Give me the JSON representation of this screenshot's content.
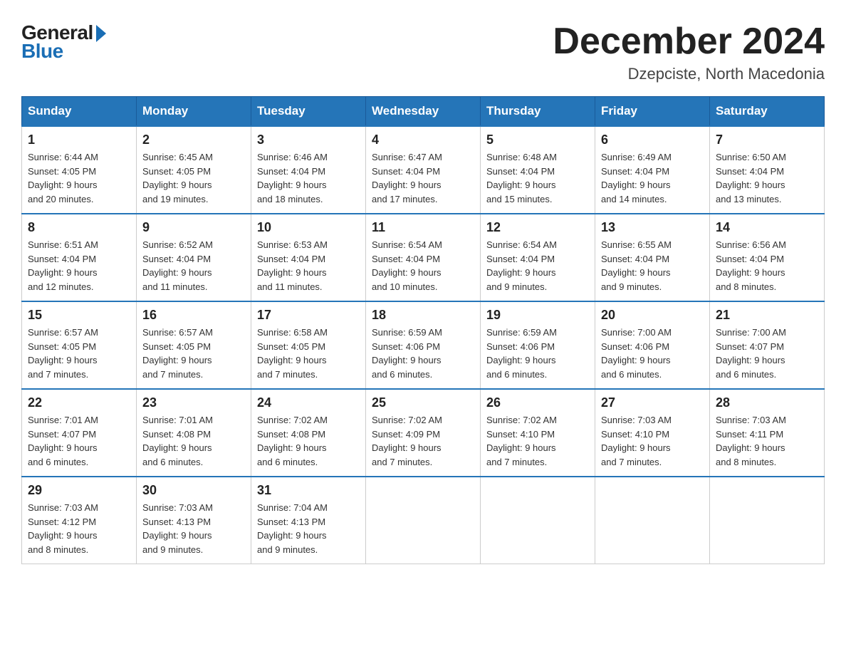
{
  "header": {
    "logo": {
      "general": "General",
      "blue": "Blue"
    },
    "title": "December 2024",
    "location": "Dzepciste, North Macedonia"
  },
  "days_header": [
    "Sunday",
    "Monday",
    "Tuesday",
    "Wednesday",
    "Thursday",
    "Friday",
    "Saturday"
  ],
  "weeks": [
    [
      {
        "day": "1",
        "sunrise": "6:44 AM",
        "sunset": "4:05 PM",
        "daylight": "9 hours and 20 minutes."
      },
      {
        "day": "2",
        "sunrise": "6:45 AM",
        "sunset": "4:05 PM",
        "daylight": "9 hours and 19 minutes."
      },
      {
        "day": "3",
        "sunrise": "6:46 AM",
        "sunset": "4:04 PM",
        "daylight": "9 hours and 18 minutes."
      },
      {
        "day": "4",
        "sunrise": "6:47 AM",
        "sunset": "4:04 PM",
        "daylight": "9 hours and 17 minutes."
      },
      {
        "day": "5",
        "sunrise": "6:48 AM",
        "sunset": "4:04 PM",
        "daylight": "9 hours and 15 minutes."
      },
      {
        "day": "6",
        "sunrise": "6:49 AM",
        "sunset": "4:04 PM",
        "daylight": "9 hours and 14 minutes."
      },
      {
        "day": "7",
        "sunrise": "6:50 AM",
        "sunset": "4:04 PM",
        "daylight": "9 hours and 13 minutes."
      }
    ],
    [
      {
        "day": "8",
        "sunrise": "6:51 AM",
        "sunset": "4:04 PM",
        "daylight": "9 hours and 12 minutes."
      },
      {
        "day": "9",
        "sunrise": "6:52 AM",
        "sunset": "4:04 PM",
        "daylight": "9 hours and 11 minutes."
      },
      {
        "day": "10",
        "sunrise": "6:53 AM",
        "sunset": "4:04 PM",
        "daylight": "9 hours and 11 minutes."
      },
      {
        "day": "11",
        "sunrise": "6:54 AM",
        "sunset": "4:04 PM",
        "daylight": "9 hours and 10 minutes."
      },
      {
        "day": "12",
        "sunrise": "6:54 AM",
        "sunset": "4:04 PM",
        "daylight": "9 hours and 9 minutes."
      },
      {
        "day": "13",
        "sunrise": "6:55 AM",
        "sunset": "4:04 PM",
        "daylight": "9 hours and 9 minutes."
      },
      {
        "day": "14",
        "sunrise": "6:56 AM",
        "sunset": "4:04 PM",
        "daylight": "9 hours and 8 minutes."
      }
    ],
    [
      {
        "day": "15",
        "sunrise": "6:57 AM",
        "sunset": "4:05 PM",
        "daylight": "9 hours and 7 minutes."
      },
      {
        "day": "16",
        "sunrise": "6:57 AM",
        "sunset": "4:05 PM",
        "daylight": "9 hours and 7 minutes."
      },
      {
        "day": "17",
        "sunrise": "6:58 AM",
        "sunset": "4:05 PM",
        "daylight": "9 hours and 7 minutes."
      },
      {
        "day": "18",
        "sunrise": "6:59 AM",
        "sunset": "4:06 PM",
        "daylight": "9 hours and 6 minutes."
      },
      {
        "day": "19",
        "sunrise": "6:59 AM",
        "sunset": "4:06 PM",
        "daylight": "9 hours and 6 minutes."
      },
      {
        "day": "20",
        "sunrise": "7:00 AM",
        "sunset": "4:06 PM",
        "daylight": "9 hours and 6 minutes."
      },
      {
        "day": "21",
        "sunrise": "7:00 AM",
        "sunset": "4:07 PM",
        "daylight": "9 hours and 6 minutes."
      }
    ],
    [
      {
        "day": "22",
        "sunrise": "7:01 AM",
        "sunset": "4:07 PM",
        "daylight": "9 hours and 6 minutes."
      },
      {
        "day": "23",
        "sunrise": "7:01 AM",
        "sunset": "4:08 PM",
        "daylight": "9 hours and 6 minutes."
      },
      {
        "day": "24",
        "sunrise": "7:02 AM",
        "sunset": "4:08 PM",
        "daylight": "9 hours and 6 minutes."
      },
      {
        "day": "25",
        "sunrise": "7:02 AM",
        "sunset": "4:09 PM",
        "daylight": "9 hours and 7 minutes."
      },
      {
        "day": "26",
        "sunrise": "7:02 AM",
        "sunset": "4:10 PM",
        "daylight": "9 hours and 7 minutes."
      },
      {
        "day": "27",
        "sunrise": "7:03 AM",
        "sunset": "4:10 PM",
        "daylight": "9 hours and 7 minutes."
      },
      {
        "day": "28",
        "sunrise": "7:03 AM",
        "sunset": "4:11 PM",
        "daylight": "9 hours and 8 minutes."
      }
    ],
    [
      {
        "day": "29",
        "sunrise": "7:03 AM",
        "sunset": "4:12 PM",
        "daylight": "9 hours and 8 minutes."
      },
      {
        "day": "30",
        "sunrise": "7:03 AM",
        "sunset": "4:13 PM",
        "daylight": "9 hours and 9 minutes."
      },
      {
        "day": "31",
        "sunrise": "7:04 AM",
        "sunset": "4:13 PM",
        "daylight": "9 hours and 9 minutes."
      },
      null,
      null,
      null,
      null
    ]
  ],
  "labels": {
    "sunrise": "Sunrise:",
    "sunset": "Sunset:",
    "daylight": "Daylight:"
  }
}
